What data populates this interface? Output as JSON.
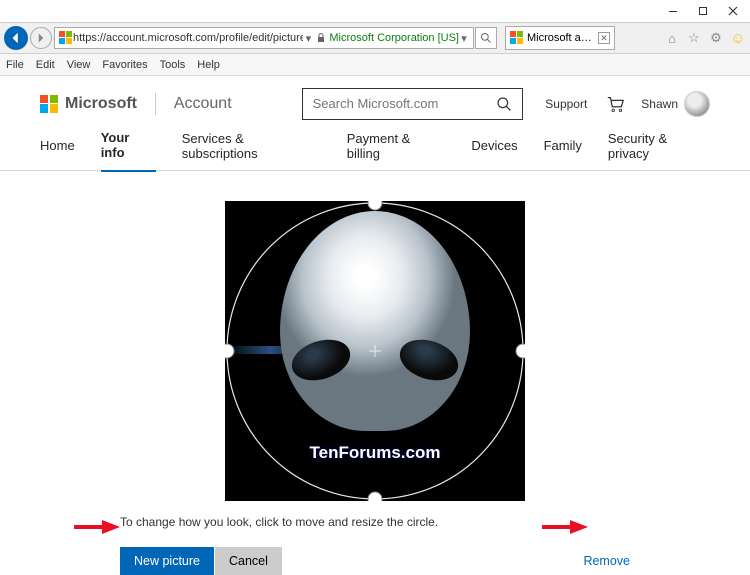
{
  "window": {
    "min": "—",
    "max": "☐",
    "close": "✕"
  },
  "ie": {
    "url": "https://account.microsoft.com/profile/edit/picture?ru=https://account.microsoft.com#/",
    "cert": "Microsoft Corporation [US]",
    "tab_title": "Microsoft account | Yo..."
  },
  "menu": {
    "file": "File",
    "edit": "Edit",
    "view": "View",
    "favorites": "Favorites",
    "tools": "Tools",
    "help": "Help"
  },
  "header": {
    "brand": "Microsoft",
    "section": "Account",
    "search_placeholder": "Search Microsoft.com",
    "support": "Support",
    "user_name": "Shawn"
  },
  "nav": {
    "home": "Home",
    "your_info": "Your info",
    "services": "Services & subscriptions",
    "payment": "Payment & billing",
    "devices": "Devices",
    "family": "Family",
    "security": "Security & privacy"
  },
  "editor": {
    "watermark": "TenForums.com",
    "hint": "To change how you look, click to move and resize the circle.",
    "new_picture": "New picture",
    "cancel": "Cancel",
    "remove": "Remove"
  }
}
